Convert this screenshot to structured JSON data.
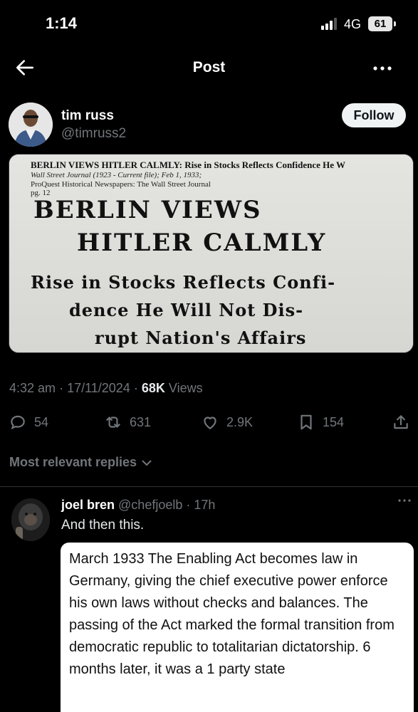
{
  "status_bar": {
    "time": "1:14",
    "network": "4G",
    "battery": "61"
  },
  "header": {
    "title": "Post"
  },
  "post": {
    "author_name": "tim russ",
    "author_handle": "@timruss2",
    "follow_label": "Follow",
    "clipping": {
      "line1": "BERLIN VIEWS HITLER CALMLY: Rise in Stocks Reflects Confidence He W",
      "line2": "Wall Street Journal (1923 - Current file); Feb 1, 1933;",
      "line3": "ProQuest Historical Newspapers: The Wall Street Journal",
      "line4": "pg. 12",
      "headline1": "BERLIN VIEWS",
      "headline2": "HITLER CALMLY",
      "sub1": "Rise in Stocks Reflects Confi-",
      "sub2": "dence He Will Not Dis-",
      "sub3": "rupt Nation's Affairs"
    },
    "time": "4:32 am",
    "date": "17/11/2024",
    "views_count": "68K",
    "views_label": "Views",
    "replies": "54",
    "reposts": "631",
    "likes": "2.9K",
    "bookmarks": "154"
  },
  "replies_filter": {
    "label": "Most relevant replies"
  },
  "reply": {
    "name": "joel bren",
    "handle": "@chefjoelb",
    "age": "17h",
    "text": "And then this.",
    "quote": "March 1933 The Enabling Act becomes law in Germany, giving the chief executive power enforce his own laws without checks and balances. The passing of the Act marked the formal transition from democratic republic to totalitarian dictatorship. 6 months later, it was a 1 party state"
  },
  "colors": {
    "background": "#000000",
    "muted": "#71767b",
    "text": "#e7e9ea",
    "follow_bg": "#eff3f4"
  },
  "icons": [
    "back-arrow-icon",
    "more-icon",
    "reply-icon",
    "repost-icon",
    "like-icon",
    "bookmark-icon",
    "share-icon",
    "chevron-down-icon"
  ]
}
